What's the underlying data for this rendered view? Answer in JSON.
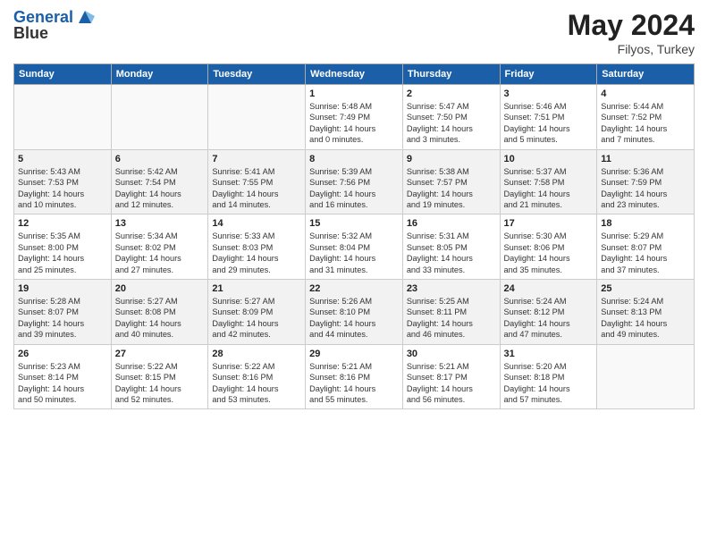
{
  "header": {
    "logo_line1": "General",
    "logo_line2": "Blue",
    "month_year": "May 2024",
    "location": "Filyos, Turkey"
  },
  "weekdays": [
    "Sunday",
    "Monday",
    "Tuesday",
    "Wednesday",
    "Thursday",
    "Friday",
    "Saturday"
  ],
  "weeks": [
    [
      {
        "day": "",
        "sunrise": "",
        "sunset": "",
        "daylight": ""
      },
      {
        "day": "",
        "sunrise": "",
        "sunset": "",
        "daylight": ""
      },
      {
        "day": "",
        "sunrise": "",
        "sunset": "",
        "daylight": ""
      },
      {
        "day": "1",
        "sunrise": "Sunrise: 5:48 AM",
        "sunset": "Sunset: 7:49 PM",
        "daylight": "Daylight: 14 hours and 0 minutes."
      },
      {
        "day": "2",
        "sunrise": "Sunrise: 5:47 AM",
        "sunset": "Sunset: 7:50 PM",
        "daylight": "Daylight: 14 hours and 3 minutes."
      },
      {
        "day": "3",
        "sunrise": "Sunrise: 5:46 AM",
        "sunset": "Sunset: 7:51 PM",
        "daylight": "Daylight: 14 hours and 5 minutes."
      },
      {
        "day": "4",
        "sunrise": "Sunrise: 5:44 AM",
        "sunset": "Sunset: 7:52 PM",
        "daylight": "Daylight: 14 hours and 7 minutes."
      }
    ],
    [
      {
        "day": "5",
        "sunrise": "Sunrise: 5:43 AM",
        "sunset": "Sunset: 7:53 PM",
        "daylight": "Daylight: 14 hours and 10 minutes."
      },
      {
        "day": "6",
        "sunrise": "Sunrise: 5:42 AM",
        "sunset": "Sunset: 7:54 PM",
        "daylight": "Daylight: 14 hours and 12 minutes."
      },
      {
        "day": "7",
        "sunrise": "Sunrise: 5:41 AM",
        "sunset": "Sunset: 7:55 PM",
        "daylight": "Daylight: 14 hours and 14 minutes."
      },
      {
        "day": "8",
        "sunrise": "Sunrise: 5:39 AM",
        "sunset": "Sunset: 7:56 PM",
        "daylight": "Daylight: 14 hours and 16 minutes."
      },
      {
        "day": "9",
        "sunrise": "Sunrise: 5:38 AM",
        "sunset": "Sunset: 7:57 PM",
        "daylight": "Daylight: 14 hours and 19 minutes."
      },
      {
        "day": "10",
        "sunrise": "Sunrise: 5:37 AM",
        "sunset": "Sunset: 7:58 PM",
        "daylight": "Daylight: 14 hours and 21 minutes."
      },
      {
        "day": "11",
        "sunrise": "Sunrise: 5:36 AM",
        "sunset": "Sunset: 7:59 PM",
        "daylight": "Daylight: 14 hours and 23 minutes."
      }
    ],
    [
      {
        "day": "12",
        "sunrise": "Sunrise: 5:35 AM",
        "sunset": "Sunset: 8:00 PM",
        "daylight": "Daylight: 14 hours and 25 minutes."
      },
      {
        "day": "13",
        "sunrise": "Sunrise: 5:34 AM",
        "sunset": "Sunset: 8:02 PM",
        "daylight": "Daylight: 14 hours and 27 minutes."
      },
      {
        "day": "14",
        "sunrise": "Sunrise: 5:33 AM",
        "sunset": "Sunset: 8:03 PM",
        "daylight": "Daylight: 14 hours and 29 minutes."
      },
      {
        "day": "15",
        "sunrise": "Sunrise: 5:32 AM",
        "sunset": "Sunset: 8:04 PM",
        "daylight": "Daylight: 14 hours and 31 minutes."
      },
      {
        "day": "16",
        "sunrise": "Sunrise: 5:31 AM",
        "sunset": "Sunset: 8:05 PM",
        "daylight": "Daylight: 14 hours and 33 minutes."
      },
      {
        "day": "17",
        "sunrise": "Sunrise: 5:30 AM",
        "sunset": "Sunset: 8:06 PM",
        "daylight": "Daylight: 14 hours and 35 minutes."
      },
      {
        "day": "18",
        "sunrise": "Sunrise: 5:29 AM",
        "sunset": "Sunset: 8:07 PM",
        "daylight": "Daylight: 14 hours and 37 minutes."
      }
    ],
    [
      {
        "day": "19",
        "sunrise": "Sunrise: 5:28 AM",
        "sunset": "Sunset: 8:07 PM",
        "daylight": "Daylight: 14 hours and 39 minutes."
      },
      {
        "day": "20",
        "sunrise": "Sunrise: 5:27 AM",
        "sunset": "Sunset: 8:08 PM",
        "daylight": "Daylight: 14 hours and 40 minutes."
      },
      {
        "day": "21",
        "sunrise": "Sunrise: 5:27 AM",
        "sunset": "Sunset: 8:09 PM",
        "daylight": "Daylight: 14 hours and 42 minutes."
      },
      {
        "day": "22",
        "sunrise": "Sunrise: 5:26 AM",
        "sunset": "Sunset: 8:10 PM",
        "daylight": "Daylight: 14 hours and 44 minutes."
      },
      {
        "day": "23",
        "sunrise": "Sunrise: 5:25 AM",
        "sunset": "Sunset: 8:11 PM",
        "daylight": "Daylight: 14 hours and 46 minutes."
      },
      {
        "day": "24",
        "sunrise": "Sunrise: 5:24 AM",
        "sunset": "Sunset: 8:12 PM",
        "daylight": "Daylight: 14 hours and 47 minutes."
      },
      {
        "day": "25",
        "sunrise": "Sunrise: 5:24 AM",
        "sunset": "Sunset: 8:13 PM",
        "daylight": "Daylight: 14 hours and 49 minutes."
      }
    ],
    [
      {
        "day": "26",
        "sunrise": "Sunrise: 5:23 AM",
        "sunset": "Sunset: 8:14 PM",
        "daylight": "Daylight: 14 hours and 50 minutes."
      },
      {
        "day": "27",
        "sunrise": "Sunrise: 5:22 AM",
        "sunset": "Sunset: 8:15 PM",
        "daylight": "Daylight: 14 hours and 52 minutes."
      },
      {
        "day": "28",
        "sunrise": "Sunrise: 5:22 AM",
        "sunset": "Sunset: 8:16 PM",
        "daylight": "Daylight: 14 hours and 53 minutes."
      },
      {
        "day": "29",
        "sunrise": "Sunrise: 5:21 AM",
        "sunset": "Sunset: 8:16 PM",
        "daylight": "Daylight: 14 hours and 55 minutes."
      },
      {
        "day": "30",
        "sunrise": "Sunrise: 5:21 AM",
        "sunset": "Sunset: 8:17 PM",
        "daylight": "Daylight: 14 hours and 56 minutes."
      },
      {
        "day": "31",
        "sunrise": "Sunrise: 5:20 AM",
        "sunset": "Sunset: 8:18 PM",
        "daylight": "Daylight: 14 hours and 57 minutes."
      },
      {
        "day": "",
        "sunrise": "",
        "sunset": "",
        "daylight": ""
      }
    ]
  ]
}
